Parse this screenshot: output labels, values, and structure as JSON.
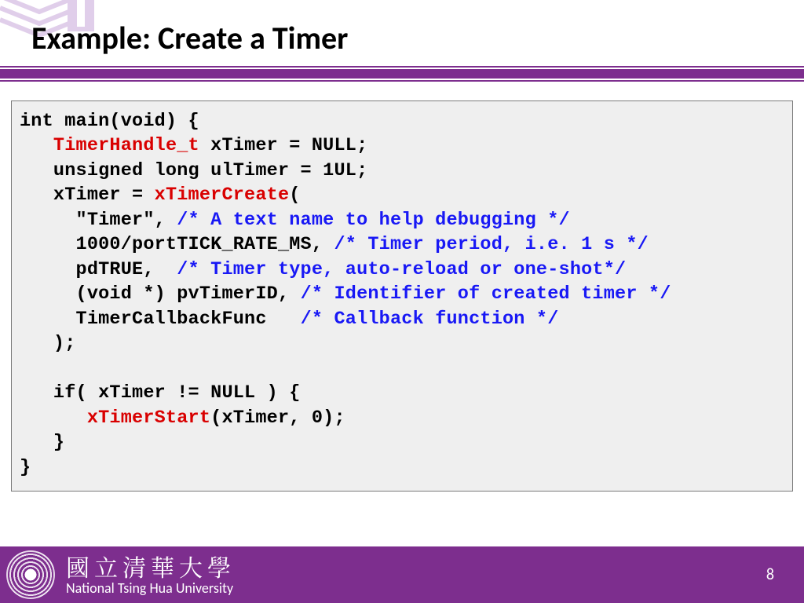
{
  "slide": {
    "title": "Example: Create a Timer",
    "page_number": "8"
  },
  "footer": {
    "university_cn": "國立清華大學",
    "university_en": "National Tsing Hua University"
  },
  "code": {
    "l1": "int main(void) {",
    "l2a": "   ",
    "l2_red": "TimerHandle_t",
    "l2b": " xTimer = NULL;",
    "l3": "   unsigned long ulTimer = 1UL;",
    "l4a": "   xTimer = ",
    "l4_red": "xTimerCreate",
    "l4b": "(",
    "l5a": "     \"Timer\", ",
    "l5_cmt": "/* A text name to help debugging */",
    "l6a": "     1000/portTICK_RATE_MS, ",
    "l6_cmt": "/* Timer period, i.e. 1 s */",
    "l7a": "     pdTRUE,  ",
    "l7_cmt": "/* Timer type, auto-reload or one-shot*/",
    "l8a": "     (void *) pvTimerID, ",
    "l8_cmt": "/* Identifier of created timer */",
    "l9a": "     TimerCallbackFunc   ",
    "l9_cmt": "/* Callback function */",
    "l10": "   );",
    "l11": "",
    "l12": "   if( xTimer != NULL ) {",
    "l13a": "      ",
    "l13_red": "xTimerStart",
    "l13b": "(xTimer, 0);",
    "l14": "   }",
    "l15": "}"
  }
}
